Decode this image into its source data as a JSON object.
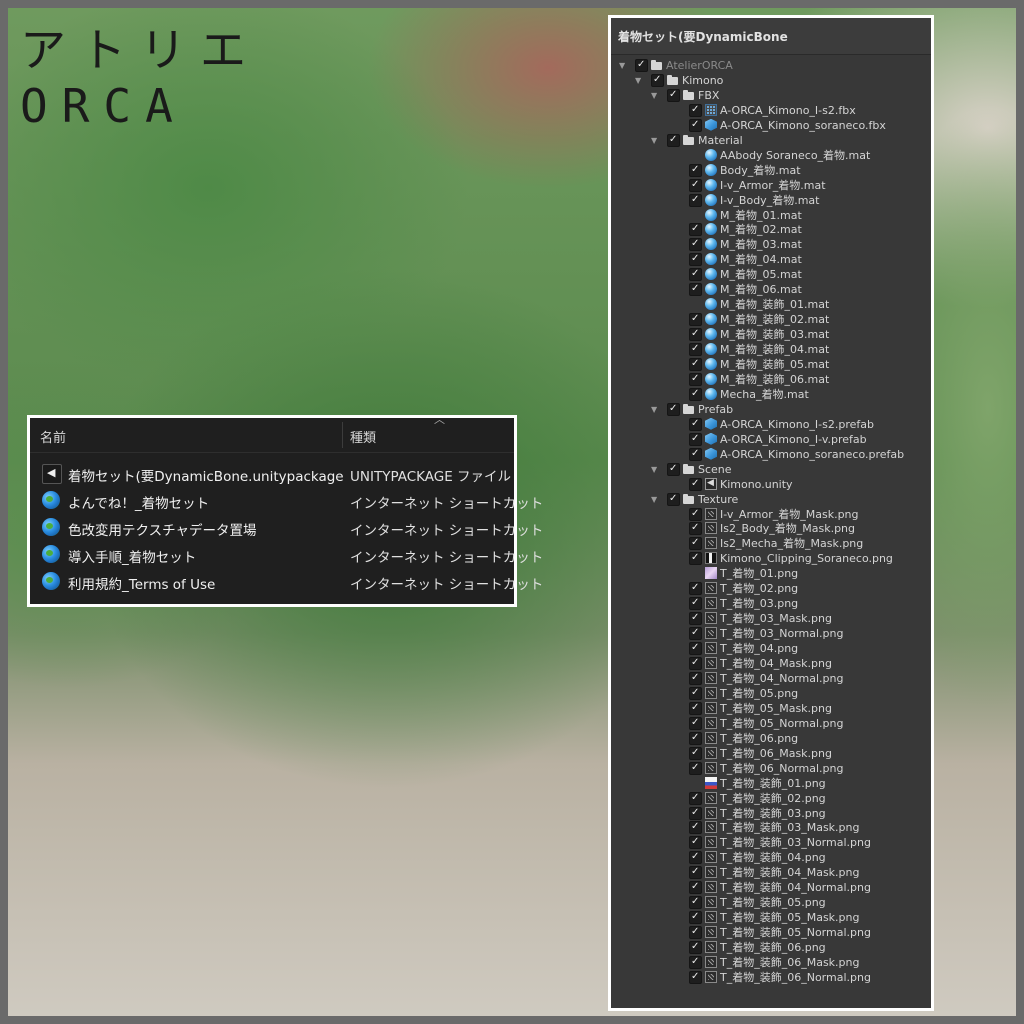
{
  "logo": {
    "line1": "アトリエ",
    "line2": "ORCA"
  },
  "explorer": {
    "columns": {
      "name": "名前",
      "type": "種類"
    },
    "rows": [
      {
        "icon": "unity-package-icon",
        "name": "着物セット(要DynamicBone.unitypackage",
        "type": "UNITYPACKAGE ファイル"
      },
      {
        "icon": "globe-icon",
        "name": "よんでね！_着物セット",
        "type": "インターネット ショートカット"
      },
      {
        "icon": "globe-icon",
        "name": "色改変用テクスチャデータ置場",
        "type": "インターネット ショートカット"
      },
      {
        "icon": "globe-icon",
        "name": "導入手順_着物セット",
        "type": "インターネット ショートカット"
      },
      {
        "icon": "globe-icon",
        "name": "利用規約_Terms of Use",
        "type": "インターネット ショートカット"
      }
    ]
  },
  "unity": {
    "title": "着物セット(要DynamicBone",
    "tree": [
      {
        "depth": 0,
        "label": "AtelierORCA",
        "icon": "folder",
        "expand": true,
        "checked": true,
        "dim": true
      },
      {
        "depth": 1,
        "label": "Kimono",
        "icon": "folder",
        "expand": true,
        "checked": true
      },
      {
        "depth": 2,
        "label": "FBX",
        "icon": "folder",
        "expand": true,
        "checked": true
      },
      {
        "depth": 3,
        "label": "A-ORCA_Kimono_I-s2.fbx",
        "icon": "fbx",
        "checked": true
      },
      {
        "depth": 3,
        "label": "A-ORCA_Kimono_soraneco.fbx",
        "icon": "prefab",
        "checked": true
      },
      {
        "depth": 2,
        "label": "Material",
        "icon": "folder",
        "expand": true,
        "checked": true
      },
      {
        "depth": 3,
        "label": "AAbody Soraneco_着物.mat",
        "icon": "material",
        "checked": false
      },
      {
        "depth": 3,
        "label": "Body_着物.mat",
        "icon": "material",
        "checked": true
      },
      {
        "depth": 3,
        "label": "I-v_Armor_着物.mat",
        "icon": "material",
        "checked": true
      },
      {
        "depth": 3,
        "label": "I-v_Body_着物.mat",
        "icon": "material",
        "checked": true
      },
      {
        "depth": 3,
        "label": "M_着物_01.mat",
        "icon": "material",
        "checked": false
      },
      {
        "depth": 3,
        "label": "M_着物_02.mat",
        "icon": "material",
        "checked": true
      },
      {
        "depth": 3,
        "label": "M_着物_03.mat",
        "icon": "material",
        "checked": true
      },
      {
        "depth": 3,
        "label": "M_着物_04.mat",
        "icon": "material",
        "checked": true
      },
      {
        "depth": 3,
        "label": "M_着物_05.mat",
        "icon": "material",
        "checked": true
      },
      {
        "depth": 3,
        "label": "M_着物_06.mat",
        "icon": "material",
        "checked": true
      },
      {
        "depth": 3,
        "label": "M_着物_装飾_01.mat",
        "icon": "material",
        "checked": false
      },
      {
        "depth": 3,
        "label": "M_着物_装飾_02.mat",
        "icon": "material",
        "checked": true
      },
      {
        "depth": 3,
        "label": "M_着物_装飾_03.mat",
        "icon": "material",
        "checked": true
      },
      {
        "depth": 3,
        "label": "M_着物_装飾_04.mat",
        "icon": "material",
        "checked": true
      },
      {
        "depth": 3,
        "label": "M_着物_装飾_05.mat",
        "icon": "material",
        "checked": true
      },
      {
        "depth": 3,
        "label": "M_着物_装飾_06.mat",
        "icon": "material",
        "checked": true
      },
      {
        "depth": 3,
        "label": "Mecha_着物.mat",
        "icon": "material",
        "checked": true
      },
      {
        "depth": 2,
        "label": "Prefab",
        "icon": "folder",
        "expand": true,
        "checked": true
      },
      {
        "depth": 3,
        "label": "A-ORCA_Kimono_I-s2.prefab",
        "icon": "prefab",
        "checked": true
      },
      {
        "depth": 3,
        "label": "A-ORCA_Kimono_I-v.prefab",
        "icon": "prefab",
        "checked": true
      },
      {
        "depth": 3,
        "label": "A-ORCA_Kimono_soraneco.prefab",
        "icon": "prefab",
        "checked": true
      },
      {
        "depth": 2,
        "label": "Scene",
        "icon": "folder",
        "expand": true,
        "checked": true
      },
      {
        "depth": 3,
        "label": "Kimono.unity",
        "icon": "scene",
        "checked": true
      },
      {
        "depth": 2,
        "label": "Texture",
        "icon": "folder",
        "expand": true,
        "checked": true
      },
      {
        "depth": 3,
        "label": "I-v_Armor_着物_Mask.png",
        "icon": "texture",
        "checked": true
      },
      {
        "depth": 3,
        "label": "Is2_Body_着物_Mask.png",
        "icon": "texture",
        "checked": true
      },
      {
        "depth": 3,
        "label": "Is2_Mecha_着物_Mask.png",
        "icon": "texture",
        "checked": true
      },
      {
        "depth": 3,
        "label": "Kimono_Clipping_Soraneco.png",
        "icon": "thumb-a",
        "checked": true
      },
      {
        "depth": 3,
        "label": "T_着物_01.png",
        "icon": "thumb-b",
        "checked": false
      },
      {
        "depth": 3,
        "label": "T_着物_02.png",
        "icon": "texture",
        "checked": true
      },
      {
        "depth": 3,
        "label": "T_着物_03.png",
        "icon": "texture",
        "checked": true
      },
      {
        "depth": 3,
        "label": "T_着物_03_Mask.png",
        "icon": "texture",
        "checked": true
      },
      {
        "depth": 3,
        "label": "T_着物_03_Normal.png",
        "icon": "texture",
        "checked": true
      },
      {
        "depth": 3,
        "label": "T_着物_04.png",
        "icon": "texture",
        "checked": true
      },
      {
        "depth": 3,
        "label": "T_着物_04_Mask.png",
        "icon": "texture",
        "checked": true
      },
      {
        "depth": 3,
        "label": "T_着物_04_Normal.png",
        "icon": "texture",
        "checked": true
      },
      {
        "depth": 3,
        "label": "T_着物_05.png",
        "icon": "texture",
        "checked": true
      },
      {
        "depth": 3,
        "label": "T_着物_05_Mask.png",
        "icon": "texture",
        "checked": true
      },
      {
        "depth": 3,
        "label": "T_着物_05_Normal.png",
        "icon": "texture",
        "checked": true
      },
      {
        "depth": 3,
        "label": "T_着物_06.png",
        "icon": "texture",
        "checked": true
      },
      {
        "depth": 3,
        "label": "T_着物_06_Mask.png",
        "icon": "texture",
        "checked": true
      },
      {
        "depth": 3,
        "label": "T_着物_06_Normal.png",
        "icon": "texture",
        "checked": true
      },
      {
        "depth": 3,
        "label": "T_着物_装飾_01.png",
        "icon": "thumb-c",
        "checked": false
      },
      {
        "depth": 3,
        "label": "T_着物_装飾_02.png",
        "icon": "texture",
        "checked": true
      },
      {
        "depth": 3,
        "label": "T_着物_装飾_03.png",
        "icon": "texture",
        "checked": true
      },
      {
        "depth": 3,
        "label": "T_着物_装飾_03_Mask.png",
        "icon": "texture",
        "checked": true
      },
      {
        "depth": 3,
        "label": "T_着物_装飾_03_Normal.png",
        "icon": "texture",
        "checked": true
      },
      {
        "depth": 3,
        "label": "T_着物_装飾_04.png",
        "icon": "texture",
        "checked": true
      },
      {
        "depth": 3,
        "label": "T_着物_装飾_04_Mask.png",
        "icon": "texture",
        "checked": true
      },
      {
        "depth": 3,
        "label": "T_着物_装飾_04_Normal.png",
        "icon": "texture",
        "checked": true
      },
      {
        "depth": 3,
        "label": "T_着物_装飾_05.png",
        "icon": "texture",
        "checked": true
      },
      {
        "depth": 3,
        "label": "T_着物_装飾_05_Mask.png",
        "icon": "texture",
        "checked": true
      },
      {
        "depth": 3,
        "label": "T_着物_装飾_05_Normal.png",
        "icon": "texture",
        "checked": true
      },
      {
        "depth": 3,
        "label": "T_着物_装飾_06.png",
        "icon": "texture",
        "checked": true
      },
      {
        "depth": 3,
        "label": "T_着物_装飾_06_Mask.png",
        "icon": "texture",
        "checked": true
      },
      {
        "depth": 3,
        "label": "T_着物_装飾_06_Normal.png",
        "icon": "texture",
        "checked": true
      }
    ]
  }
}
